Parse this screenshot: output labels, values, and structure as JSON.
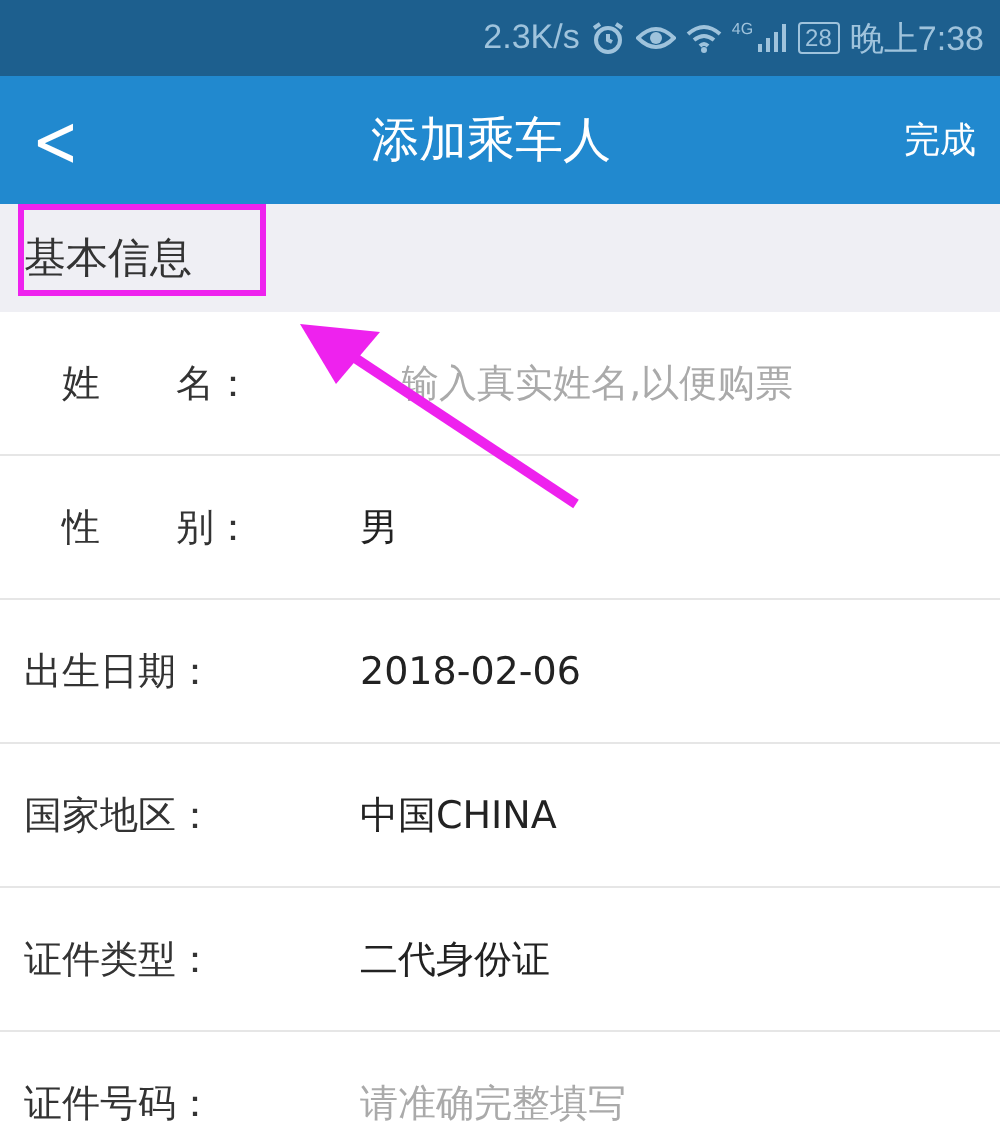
{
  "status_bar": {
    "speed": "2.3K/s",
    "network": "4G",
    "battery": "28",
    "time": "晚上7:38"
  },
  "header": {
    "back": "<",
    "title": "添加乘车人",
    "action": "完成"
  },
  "section": {
    "title": "基本信息"
  },
  "rows": [
    {
      "label": "　姓　　名：",
      "placeholder": "输入真实姓名,以便购票",
      "covered_start": true
    },
    {
      "label": "　性　　别：",
      "value": "男"
    },
    {
      "label": "出生日期：",
      "value": "2018-02-06"
    },
    {
      "label": "国家地区：",
      "value": "中国CHINA"
    },
    {
      "label": "证件类型：",
      "value": "二代身份证"
    },
    {
      "label": "证件号码：",
      "placeholder": "请准确完整填写"
    }
  ]
}
